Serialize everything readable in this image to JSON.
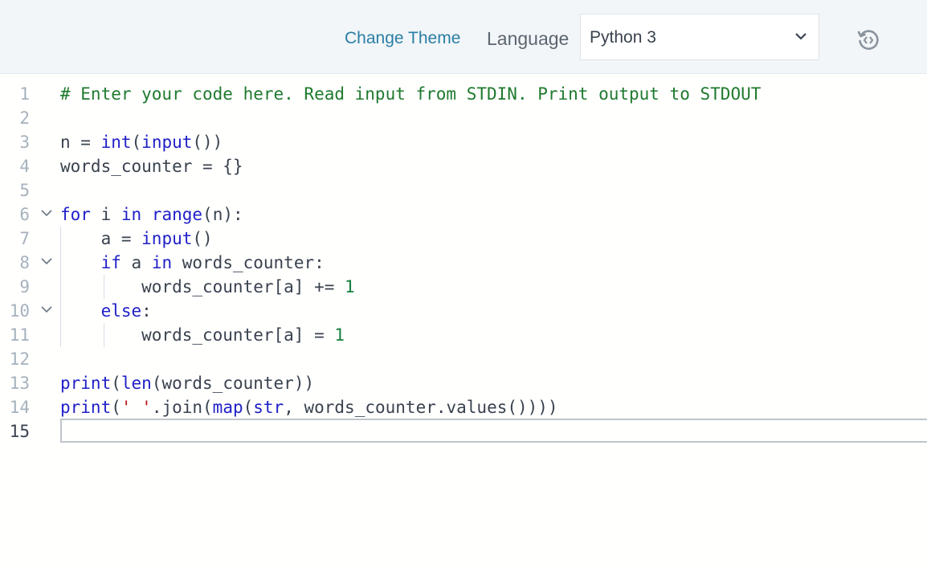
{
  "toolbar": {
    "change_theme": "Change Theme",
    "language_label": "Language",
    "language_value": "Python 3",
    "reset_icon": "history-reset-icon"
  },
  "editor": {
    "active_line": 15,
    "lines": [
      {
        "n": "1",
        "tokens": [
          [
            "cm",
            "# Enter your code here. Read input from STDIN. Print output to STDOUT"
          ]
        ]
      },
      {
        "n": "2",
        "tokens": []
      },
      {
        "n": "3",
        "tokens": [
          [
            "",
            "n = "
          ],
          [
            "kw",
            "int"
          ],
          [
            "",
            "("
          ],
          [
            "kw",
            "input"
          ],
          [
            "",
            "())"
          ]
        ]
      },
      {
        "n": "4",
        "tokens": [
          [
            "",
            "words_counter = {}"
          ]
        ]
      },
      {
        "n": "5",
        "tokens": []
      },
      {
        "n": "6",
        "fold": true,
        "tokens": [
          [
            "kw",
            "for"
          ],
          [
            "",
            " i "
          ],
          [
            "kw",
            "in"
          ],
          [
            "",
            " "
          ],
          [
            "kw",
            "range"
          ],
          [
            "",
            "(n):"
          ]
        ]
      },
      {
        "n": "7",
        "tokens": [
          [
            "",
            "    a = "
          ],
          [
            "kw",
            "input"
          ],
          [
            "",
            "()"
          ]
        ]
      },
      {
        "n": "8",
        "fold": true,
        "tokens": [
          [
            "",
            "    "
          ],
          [
            "kw",
            "if"
          ],
          [
            "",
            " a "
          ],
          [
            "kw",
            "in"
          ],
          [
            "",
            " words_counter:"
          ]
        ]
      },
      {
        "n": "9",
        "tokens": [
          [
            "",
            "        words_counter[a] += "
          ],
          [
            "num",
            "1"
          ]
        ]
      },
      {
        "n": "10",
        "fold": true,
        "tokens": [
          [
            "",
            "    "
          ],
          [
            "kw",
            "else"
          ],
          [
            "",
            ":"
          ]
        ]
      },
      {
        "n": "11",
        "tokens": [
          [
            "",
            "        words_counter[a] = "
          ],
          [
            "num",
            "1"
          ]
        ]
      },
      {
        "n": "12",
        "tokens": []
      },
      {
        "n": "13",
        "tokens": [
          [
            "kw",
            "print"
          ],
          [
            "",
            "("
          ],
          [
            "kw",
            "len"
          ],
          [
            "",
            "(words_counter))"
          ]
        ]
      },
      {
        "n": "14",
        "tokens": [
          [
            "kw",
            "print"
          ],
          [
            "",
            "("
          ],
          [
            "str",
            "' '"
          ],
          [
            "",
            ".join("
          ],
          [
            "kw",
            "map"
          ],
          [
            "",
            "("
          ],
          [
            "kw",
            "str"
          ],
          [
            "",
            ", words_counter.values())))"
          ]
        ]
      },
      {
        "n": "15",
        "tokens": []
      }
    ]
  },
  "colors": {
    "toolbar_bg": "#f2f6f8",
    "link": "#2a7ea5",
    "keyword": "#2020c8",
    "comment": "#1f7a2e",
    "number": "#15803d",
    "string": "#b41414"
  }
}
